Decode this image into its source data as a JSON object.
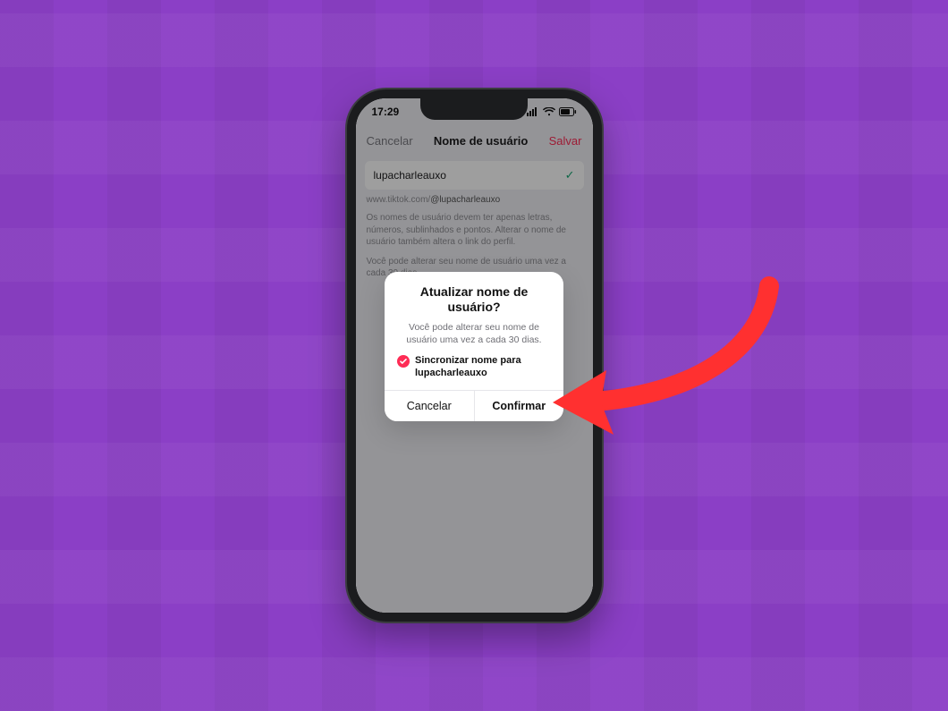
{
  "statusbar": {
    "time": "17:29"
  },
  "nav": {
    "cancel": "Cancelar",
    "title": "Nome de usuário",
    "save": "Salvar"
  },
  "field": {
    "value": "lupacharleauxo"
  },
  "link": {
    "prefix": "www.tiktok.com/",
    "handle": "@lupacharleauxo"
  },
  "help1": "Os nomes de usuário devem ter apenas letras, números, sublinhados e pontos. Alterar o nome de usuário também altera o link do perfil.",
  "help2": "Você pode alterar seu nome de usuário uma vez a cada 30 dias.",
  "alert": {
    "title": "Atualizar nome de usuário?",
    "message": "Você pode alterar seu nome de usuário uma vez a cada 30 dias.",
    "sync_label": "Sincronizar nome para lupacharleauxo",
    "cancel": "Cancelar",
    "confirm": "Confirmar"
  }
}
